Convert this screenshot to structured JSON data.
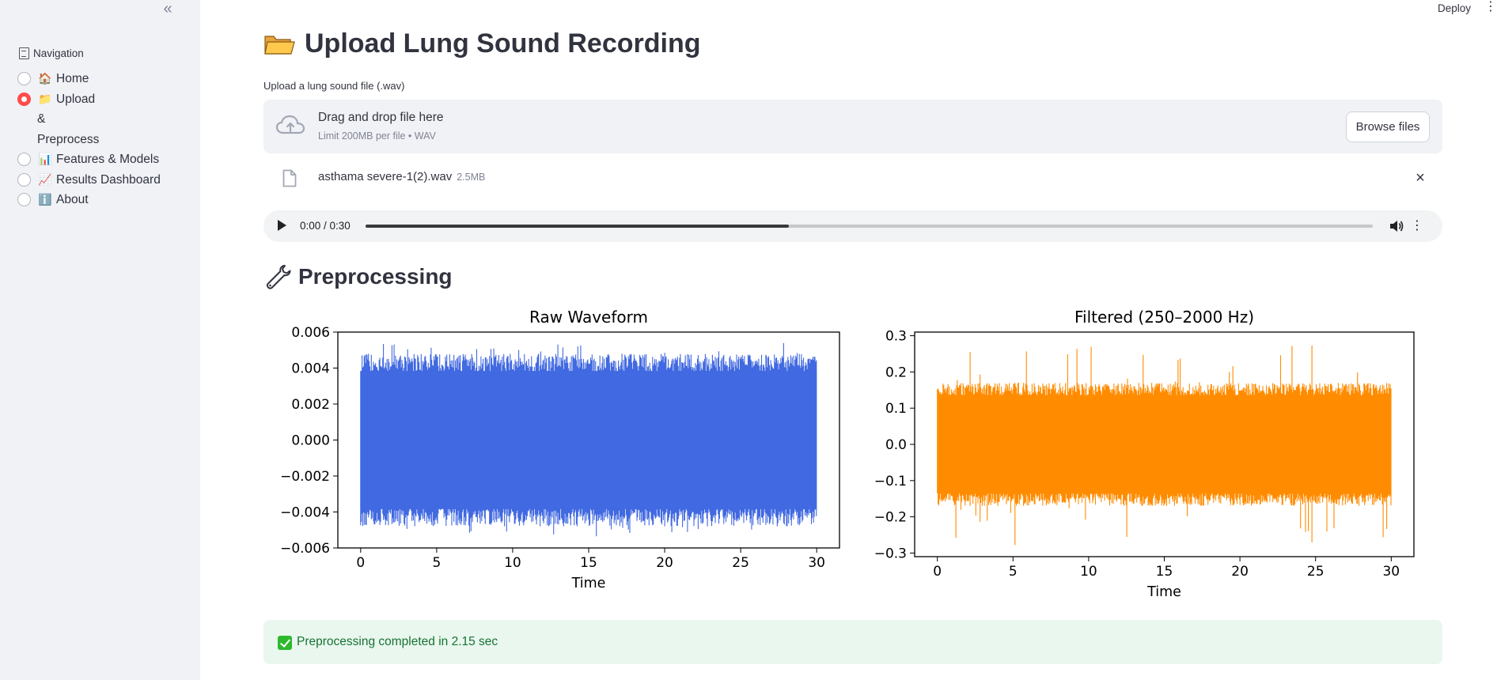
{
  "header": {
    "deploy_label": "Deploy",
    "menu_icon": "kebab-icon"
  },
  "sidebar": {
    "collapse_icon": "«",
    "title": "Navigation",
    "title_icon": "page-icon",
    "items": [
      {
        "label": "Home",
        "emoji": "🏠",
        "selected": false
      },
      {
        "label": "Upload & Preprocess",
        "emoji": "📁",
        "selected": true
      },
      {
        "label": "Features & Models",
        "emoji": "📊",
        "selected": false
      },
      {
        "label": "Results Dashboard",
        "emoji": "📈",
        "selected": false
      },
      {
        "label": "About",
        "emoji": "ℹ️",
        "selected": false
      }
    ]
  },
  "main": {
    "title": "Upload Lung Sound Recording",
    "title_icon": "open-folder-icon",
    "uploader": {
      "label": "Upload a lung sound file (.wav)",
      "dropzone_title": "Drag and drop file here",
      "dropzone_subtitle": "Limit 200MB per file • WAV",
      "browse_label": "Browse files",
      "file_name": "asthama severe-1(2).wav",
      "file_size": "2.5MB",
      "close_icon": "×"
    },
    "audio": {
      "time": "0:00 / 0:30",
      "progress": 0.42
    },
    "section_title": "Preprocessing",
    "section_icon": "wrench-icon",
    "success_message": "Preprocessing completed in 2.15 sec"
  },
  "colors": {
    "accent": "#ff4b4b",
    "raw_series": "#4169e1",
    "filtered_series": "#ff8c00",
    "success_bg": "#e9f7ee",
    "success_text": "#177233"
  },
  "chart_data": [
    {
      "type": "line",
      "title": "Raw Waveform",
      "xlabel": "Time",
      "ylabel": "",
      "xlim": [
        -1.5,
        31.5
      ],
      "ylim": [
        -0.006,
        0.006
      ],
      "xticks": [
        0,
        5,
        10,
        15,
        20,
        25,
        30
      ],
      "xtick_labels": [
        "0",
        "5",
        "10",
        "15",
        "20",
        "25",
        "30"
      ],
      "yticks": [
        0.006,
        0.004,
        0.002,
        0.0,
        -0.002,
        -0.004,
        -0.006
      ],
      "ytick_labels": [
        "0.006",
        "0.004",
        "0.002",
        "0.000",
        "−0.002",
        "−0.004",
        "−0.006"
      ],
      "series": [
        {
          "x_range": [
            0,
            30
          ],
          "amplitude": 0.0048,
          "peak": 0.0054,
          "color": "#4169e1"
        }
      ]
    },
    {
      "type": "line",
      "title": "Filtered (250–2000 Hz)",
      "xlabel": "Time",
      "ylabel": "",
      "xlim": [
        -1.5,
        31.5
      ],
      "ylim": [
        -0.31,
        0.31
      ],
      "xticks": [
        0,
        5,
        10,
        15,
        20,
        25,
        30
      ],
      "xtick_labels": [
        "0",
        "5",
        "10",
        "15",
        "20",
        "25",
        "30"
      ],
      "yticks": [
        0.3,
        0.2,
        0.1,
        0.0,
        -0.1,
        -0.2,
        -0.3
      ],
      "ytick_labels": [
        "0.3",
        "0.2",
        "0.1",
        "0.0",
        "−0.1",
        "−0.2",
        "−0.3"
      ],
      "series": [
        {
          "x_range": [
            0,
            30
          ],
          "amplitude": 0.17,
          "peak": 0.28,
          "color": "#ff8c00"
        }
      ]
    }
  ]
}
